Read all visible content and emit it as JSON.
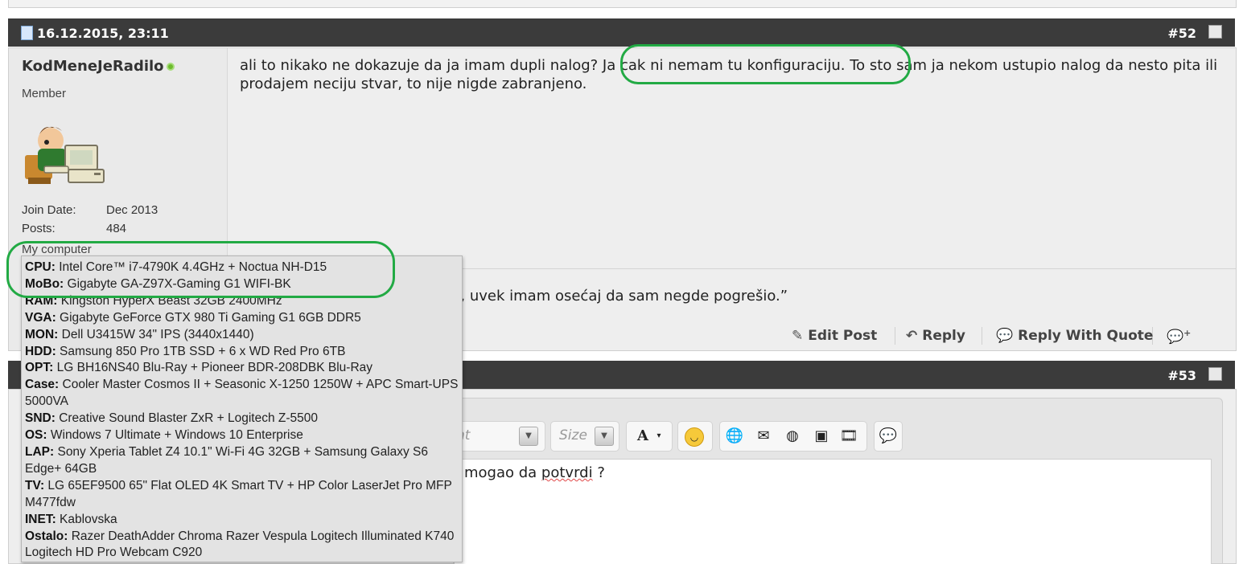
{
  "post52": {
    "date": "16.12.2015, 23:11",
    "number": "#52",
    "user": {
      "name": "KodMeneJeRadilo",
      "role": "Member",
      "join_label": "Join Date:",
      "join_value": "Dec 2013",
      "posts_label": "Posts:",
      "posts_value": "484",
      "my_computer": "My computer"
    },
    "message": "ali to nikako ne dokazuje da ja imam dupli nalog? Ja cak ni nemam tu konfiguraciju. To sto sam ja nekom ustupio nalog da nesto pita ili prodajem neciju stvar, to nije nigde zabranjeno.",
    "signature": "n, uvek imam osećaj da sam negde pogrešio.”",
    "actions": {
      "edit": "Edit Post",
      "reply": "Reply",
      "quote": "Reply With Quote"
    }
  },
  "post53": {
    "number": "#53"
  },
  "editor": {
    "font_placeholder": "nt",
    "size_placeholder": "Size",
    "text_prefix": "mogao da ",
    "text_misspelled": "potvrdi",
    "text_suffix": "  ?"
  },
  "computer_popup": [
    {
      "label": "CPU:",
      "value": " Intel Core™ i7-4790K 4.4GHz + Noctua NH-D15"
    },
    {
      "label": "MoBo:",
      "value": " Gigabyte GA-Z97X-Gaming G1 WIFI-BK"
    },
    {
      "label": "RAM:",
      "value": " Kingston HyperX Beast 32GB 2400MHz"
    },
    {
      "label": "VGA:",
      "value": " Gigabyte GeForce GTX 980 Ti Gaming G1 6GB DDR5"
    },
    {
      "label": "MON:",
      "value": " Dell U3415W 34\" IPS (3440x1440)"
    },
    {
      "label": "HDD:",
      "value": " Samsung 850 Pro 1TB SSD + 6 x WD Red Pro 6TB"
    },
    {
      "label": "OPT:",
      "value": " LG BH16NS40 Blu-Ray + Pioneer BDR-208DBK Blu-Ray"
    },
    {
      "label": "Case:",
      "value": " Cooler Master Cosmos II + Seasonic X-1250 1250W + APC Smart-UPS 5000VA"
    },
    {
      "label": "SND:",
      "value": " Creative Sound Blaster ZxR + Logitech Z-5500"
    },
    {
      "label": "OS:",
      "value": " Windows 7 Ultimate + Windows 10 Enterprise"
    },
    {
      "label": "LAP:",
      "value": " Sony Xperia Tablet Z4 10.1\" Wi-Fi 4G 32GB + Samsung Galaxy S6 Edge+ 64GB"
    },
    {
      "label": "TV:",
      "value": " LG 65EF9500 65\" Flat OLED 4K Smart TV + HP Color LaserJet Pro MFP M477fdw"
    },
    {
      "label": "INET:",
      "value": " Kablovska"
    },
    {
      "label": "Ostalo:",
      "value": " Razer DeathAdder Chroma Razer Vespula Logitech Illuminated K740 Logitech HD Pro Webcam C920"
    }
  ],
  "colors": {
    "header_bg": "#3b3b3b",
    "highlight_ring": "#22aa44",
    "online": "#6dbb2d"
  }
}
